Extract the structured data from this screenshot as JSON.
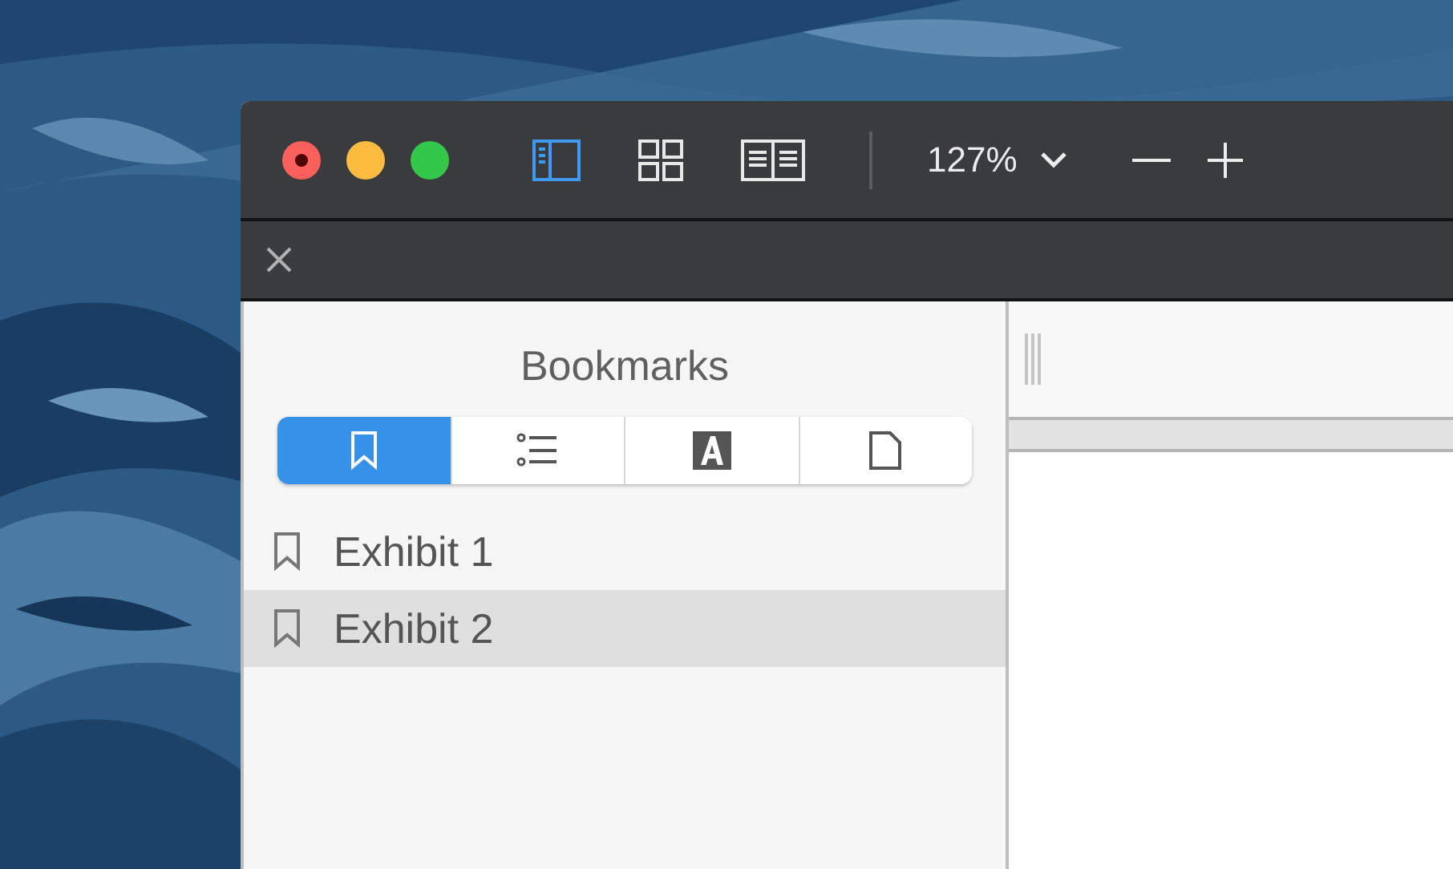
{
  "toolbar": {
    "views": [
      {
        "kind": "sidebar",
        "selected": true
      },
      {
        "kind": "grid",
        "selected": false
      },
      {
        "kind": "book",
        "selected": false
      }
    ],
    "zoom": "127%"
  },
  "sidebar": {
    "title": "Bookmarks",
    "tabs": [
      {
        "kind": "bookmark",
        "selected": true
      },
      {
        "kind": "outline",
        "selected": false
      },
      {
        "kind": "font",
        "selected": false
      },
      {
        "kind": "page",
        "selected": false
      }
    ],
    "bookmarks": [
      {
        "label": "Exhibit 1",
        "selected": false
      },
      {
        "label": "Exhibit 2",
        "selected": true
      }
    ]
  }
}
